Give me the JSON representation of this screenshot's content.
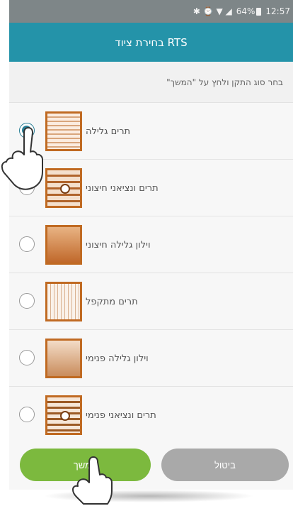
{
  "status_bar": {
    "signal_icons": "✱ ⌚ ▼ ◢",
    "battery_percent": "64%",
    "time": "12:57"
  },
  "header": {
    "title": "בחירת ציוד RTS"
  },
  "instruction": "בחר סוג התקן ולחץ על \"המשך\"",
  "devices": [
    {
      "label": "תרים גלילה",
      "icon": "roller-shutter-icon",
      "selected": true
    },
    {
      "label": "תרים ונציאני חיצוני",
      "icon": "external-venetian-icon",
      "selected": false
    },
    {
      "label": "וילון גלילה חיצוני",
      "icon": "external-roller-blind-icon",
      "selected": false
    },
    {
      "label": "תרים מתקפל",
      "icon": "folding-shutter-icon",
      "selected": false
    },
    {
      "label": "וילון גלילה פנימי",
      "icon": "internal-roller-blind-icon",
      "selected": false
    },
    {
      "label": "תרים ונציאני פנימי",
      "icon": "internal-venetian-icon",
      "selected": false
    }
  ],
  "buttons": {
    "continue": "המשך",
    "cancel": "ביטול"
  },
  "colors": {
    "header": "#2493a9",
    "continue_button": "#7cb93e",
    "cancel_button": "#a9a9a9",
    "radio_selected": "#2a7f96",
    "icon_accent": "#c06a22"
  }
}
